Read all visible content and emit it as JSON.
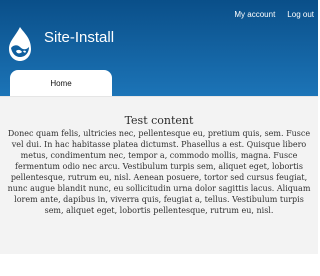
{
  "user_menu": {
    "account": "My account",
    "logout": "Log out"
  },
  "site": {
    "name": "Site-Install"
  },
  "tabs": [
    {
      "label": "Home"
    }
  ],
  "content": {
    "title": "Test content",
    "body": "Donec quam felis, ultricies nec, pellentesque eu, pretium quis, sem. Fusce vel dui. In hac habitasse platea dictumst. Phasellus a est. Quisque libero metus, condimentum nec, tempor a, commodo mollis, magna. Fusce fermentum odio nec arcu. Vestibulum turpis sem, aliquet eget, lobortis pellentesque, rutrum eu, nisl. Aenean posuere, tortor sed cursus feugiat, nunc augue blandit nunc, eu sollicitudin urna dolor sagittis lacus. Aliquam lorem ante, dapibus in, viverra quis, feugiat a, tellus. Vestibulum turpis sem, aliquet eget, lobortis pellentesque, rutrum eu, nisl."
  },
  "colors": {
    "header_dark": "#0a4f89",
    "header_light": "#1c74b7",
    "content_bg": "#f3f3f3"
  },
  "icons": {
    "logo": "drupal-drop-icon"
  }
}
